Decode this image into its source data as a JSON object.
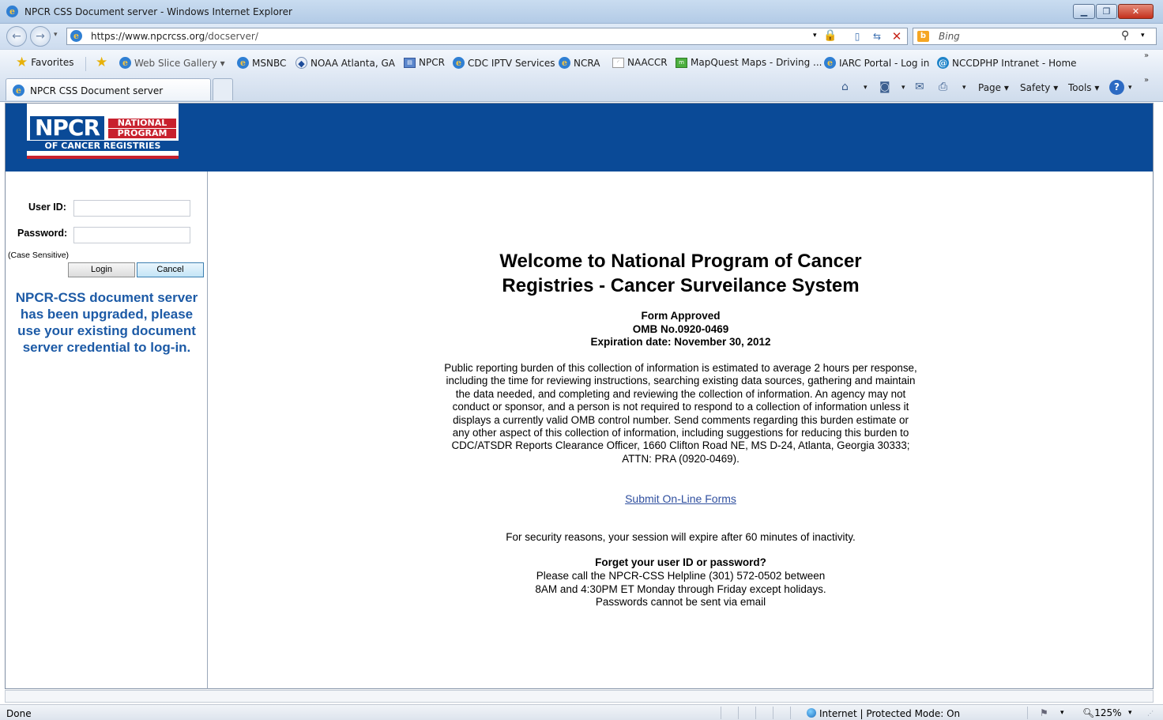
{
  "window": {
    "title": "NPCR CSS Document server - Windows Internet Explorer"
  },
  "address_bar": {
    "url_host": "https://www.npcrcss.org",
    "url_path": "/docserver/",
    "search_placeholder": "Bing"
  },
  "favorites_bar": {
    "favorites_label": "Favorites",
    "items": [
      {
        "label": "Web Slice Gallery ▾",
        "icon": "ie-icon"
      },
      {
        "label": "MSNBC",
        "icon": "ie-icon"
      },
      {
        "label": "NOAA Atlanta, GA",
        "icon": "noaa-icon"
      },
      {
        "label": "NPCR",
        "icon": "doc-icon"
      },
      {
        "label": "CDC IPTV Services",
        "icon": "ie-icon"
      },
      {
        "label": "NCRA",
        "icon": "ie-icon"
      },
      {
        "label": "NAACCR",
        "icon": "page-icon"
      },
      {
        "label": "MapQuest Maps - Driving ...",
        "icon": "map-icon"
      },
      {
        "label": "IARC Portal - Log in",
        "icon": "ie-icon"
      },
      {
        "label": "NCCDPHP Intranet - Home",
        "icon": "swirl-icon"
      }
    ]
  },
  "tabs": {
    "active_label": "NPCR CSS Document server"
  },
  "command_bar": {
    "page_label": "Page ▾",
    "safety_label": "Safety ▾",
    "tools_label": "Tools ▾"
  },
  "logo": {
    "acronym": "NPCR",
    "line1": "NATIONAL",
    "line2": "PROGRAM",
    "line3": "OF CANCER REGISTRIES"
  },
  "login": {
    "user_label": "User ID:",
    "password_label": "Password:",
    "user_value": "",
    "password_value": "",
    "case_note": "(Case Sensitive)",
    "login_button": "Login",
    "cancel_button": "Cancel",
    "notice": "NPCR-CSS document server has been upgraded, please use your existing document server credential to log-in."
  },
  "main": {
    "welcome_line1": "Welcome to National Program of Cancer",
    "welcome_line2": "Registries - Cancer Surveilance System",
    "form_approved": "Form Approved",
    "omb_number": "OMB No.0920-0469",
    "expiration": "Expiration date: November 30, 2012",
    "burden_statement": "Public reporting burden of this collection of information is estimated to average 2 hours per response, including the time for reviewing instructions, searching existing data sources, gathering and maintain the data needed, and completing and reviewing the collection of information. An agency may not conduct or sponsor, and a person is not required to respond to a collection of information unless it displays a currently valid OMB control number. Send comments regarding this burden estimate or any other aspect of this collection of information, including suggestions for reducing this burden to CDC/ATSDR Reports Clearance Officer, 1660 Clifton Road NE, MS D-24, Atlanta, Georgia 30333; ATTN: PRA (0920-0469).",
    "submit_link": "Submit On-Line Forms",
    "security_note": "For security reasons, your session will expire after 60 minutes of inactivity.",
    "forgot_title": "Forget your user ID or password?",
    "forgot_line1": "Please call the NPCR-CSS Helpline (301) 572-0502 between",
    "forgot_line2": "8AM and 4:30PM ET Monday through Friday except holidays.",
    "forgot_line3": "Passwords cannot be sent via email"
  },
  "status_bar": {
    "status": "Done",
    "zone": "Internet | Protected Mode: On",
    "zoom": "125%"
  },
  "colors": {
    "banner_blue": "#0a4a97",
    "logo_red": "#c8202d",
    "notice_blue": "#1c5aa6",
    "link_blue": "#2f4f9f"
  }
}
